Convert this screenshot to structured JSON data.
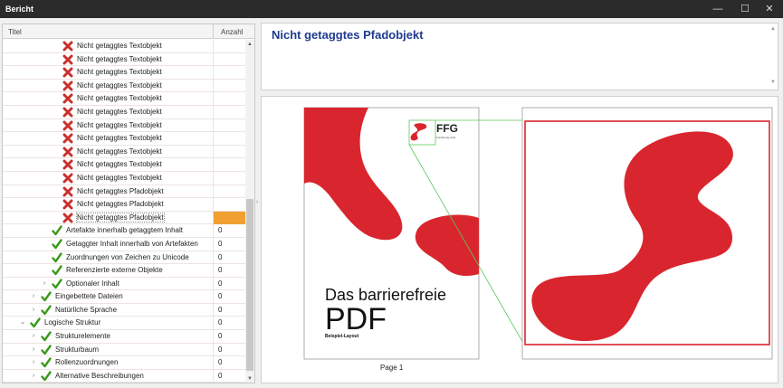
{
  "window": {
    "title": "Bericht",
    "minimize": "—",
    "maximize": "☐",
    "close": "✕"
  },
  "tree": {
    "col_title": "Titel",
    "col_count": "Anzahl",
    "rows": [
      {
        "label": "Nicht getaggtes Textobjekt",
        "count": "",
        "icon": "error",
        "indent": 5,
        "expander": false,
        "selected": false
      },
      {
        "label": "Nicht getaggtes Textobjekt",
        "count": "",
        "icon": "error",
        "indent": 5,
        "expander": false,
        "selected": false
      },
      {
        "label": "Nicht getaggtes Textobjekt",
        "count": "",
        "icon": "error",
        "indent": 5,
        "expander": false,
        "selected": false
      },
      {
        "label": "Nicht getaggtes Textobjekt",
        "count": "",
        "icon": "error",
        "indent": 5,
        "expander": false,
        "selected": false
      },
      {
        "label": "Nicht getaggtes Textobjekt",
        "count": "",
        "icon": "error",
        "indent": 5,
        "expander": false,
        "selected": false
      },
      {
        "label": "Nicht getaggtes Textobjekt",
        "count": "",
        "icon": "error",
        "indent": 5,
        "expander": false,
        "selected": false
      },
      {
        "label": "Nicht getaggtes Textobjekt",
        "count": "",
        "icon": "error",
        "indent": 5,
        "expander": false,
        "selected": false
      },
      {
        "label": "Nicht getaggtes Textobjekt",
        "count": "",
        "icon": "error",
        "indent": 5,
        "expander": false,
        "selected": false
      },
      {
        "label": "Nicht getaggtes Textobjekt",
        "count": "",
        "icon": "error",
        "indent": 5,
        "expander": false,
        "selected": false
      },
      {
        "label": "Nicht getaggtes Textobjekt",
        "count": "",
        "icon": "error",
        "indent": 5,
        "expander": false,
        "selected": false
      },
      {
        "label": "Nicht getaggtes Textobjekt",
        "count": "",
        "icon": "error",
        "indent": 5,
        "expander": false,
        "selected": false
      },
      {
        "label": "Nicht getaggtes Pfadobjekt",
        "count": "",
        "icon": "error",
        "indent": 5,
        "expander": false,
        "selected": false
      },
      {
        "label": "Nicht getaggtes Pfadobjekt",
        "count": "",
        "icon": "error",
        "indent": 5,
        "expander": false,
        "selected": false
      },
      {
        "label": "Nicht getaggtes Pfadobjekt",
        "count": "",
        "icon": "error",
        "indent": 5,
        "expander": false,
        "selected": true
      },
      {
        "label": "Artefakte innerhalb getaggtem Inhalt",
        "count": "0",
        "icon": "check",
        "indent": 4,
        "expander": false,
        "selected": false
      },
      {
        "label": "Getaggter Inhalt innerhalb von Artefakten",
        "count": "0",
        "icon": "check",
        "indent": 4,
        "expander": false,
        "selected": false
      },
      {
        "label": "Zuordnungen von Zeichen zu Unicode",
        "count": "0",
        "icon": "check",
        "indent": 4,
        "expander": false,
        "selected": false
      },
      {
        "label": "Referenzierte externe Objekte",
        "count": "0",
        "icon": "check",
        "indent": 4,
        "expander": false,
        "selected": false
      },
      {
        "label": "Optionaler Inhalt",
        "count": "0",
        "icon": "check",
        "indent": 4,
        "expander": true,
        "selected": false
      },
      {
        "label": "Eingebettete Dateien",
        "count": "0",
        "icon": "check",
        "indent": 3,
        "expander": true,
        "selected": false
      },
      {
        "label": "Natürliche Sprache",
        "count": "0",
        "icon": "check",
        "indent": 3,
        "expander": true,
        "selected": false
      },
      {
        "label": "Logische Struktur",
        "count": "0",
        "icon": "check",
        "indent": 2,
        "expander": true,
        "expanded": true,
        "selected": false
      },
      {
        "label": "Strukturelemente",
        "count": "0",
        "icon": "check",
        "indent": 3,
        "expander": true,
        "selected": false
      },
      {
        "label": "Strukturbaum",
        "count": "0",
        "icon": "check",
        "indent": 3,
        "expander": true,
        "selected": false
      },
      {
        "label": "Rollenzuordnungen",
        "count": "0",
        "icon": "check",
        "indent": 3,
        "expander": true,
        "selected": false
      },
      {
        "label": "Alternative Beschreibungen",
        "count": "0",
        "icon": "check",
        "indent": 3,
        "expander": true,
        "selected": false
      }
    ]
  },
  "detail": {
    "title": "Nicht getaggtes Pfadobjekt"
  },
  "preview": {
    "page_label": "Page 1",
    "logo_text": "FFG",
    "logo_subtext": "Forschung wirkt.",
    "headline": "Das barrierefreie",
    "headline_big": "PDF",
    "sub": "Beispiel-Layout"
  },
  "colors": {
    "accent_red": "#d9262e",
    "highlight_green": "#5cc85c",
    "title_blue": "#1f3b8f",
    "selected_count": "#f0a030",
    "error_icon": "#c9302c",
    "check_icon": "#3a9a1a"
  }
}
